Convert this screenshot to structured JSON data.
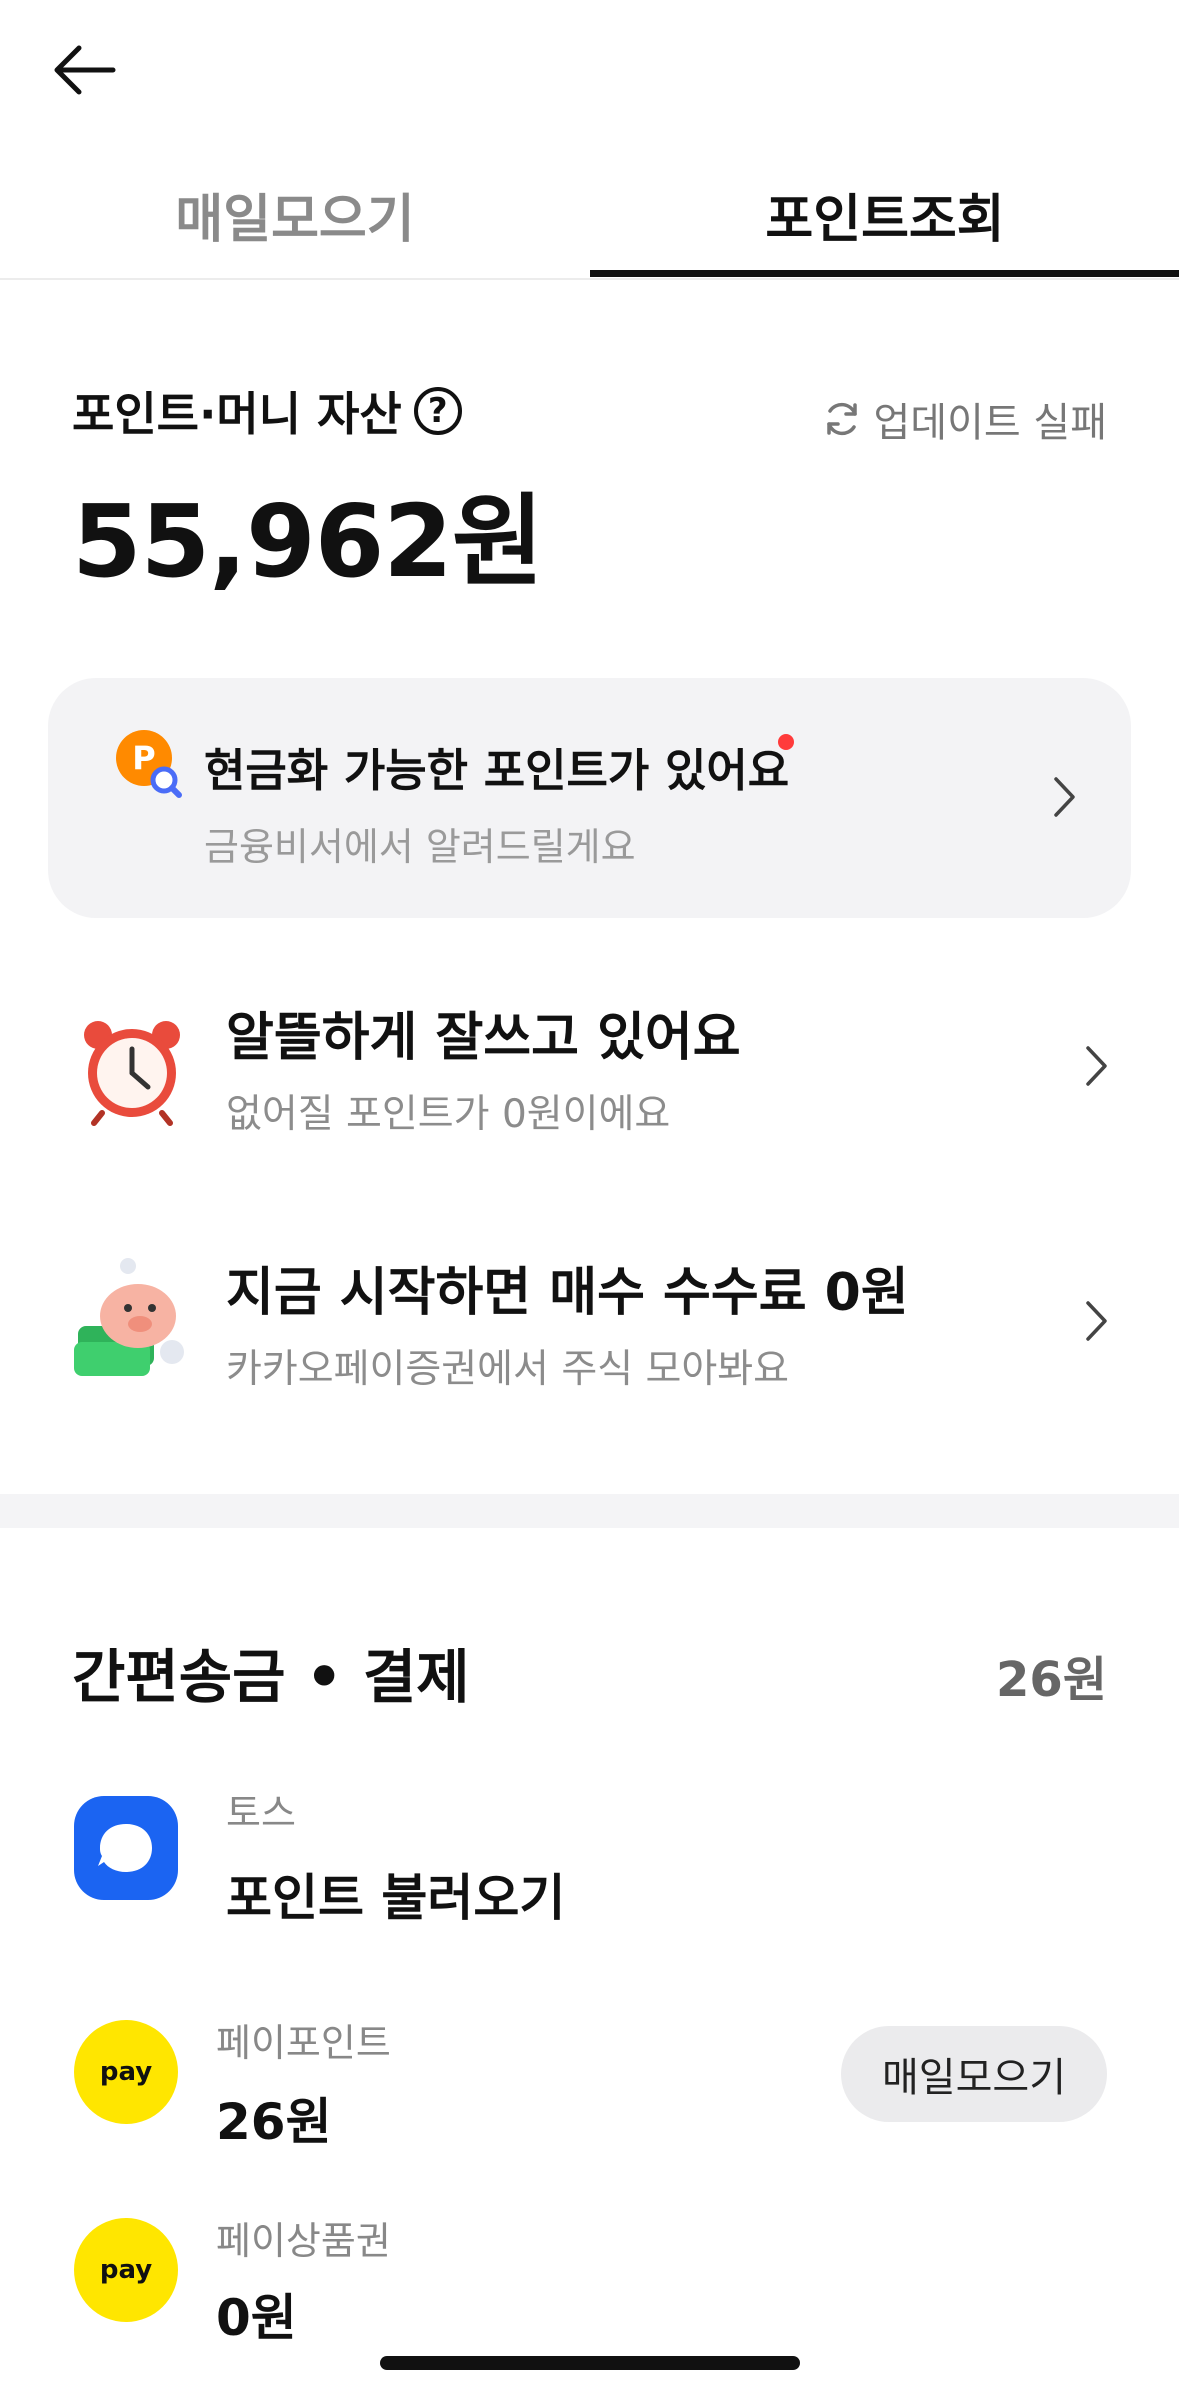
{
  "tabs": {
    "daily": "매일모으기",
    "points": "포인트조회"
  },
  "assets": {
    "title": "포인트·머니 자산",
    "help": "?",
    "update_status": "업데이트 실패",
    "amount": "55,962원"
  },
  "notice": {
    "title": "현금화 가능한 포인트가 있어요",
    "subtitle": "금융비서에서 알려드릴게요",
    "icon_letter": "P"
  },
  "rows": [
    {
      "title": "알뜰하게 잘쓰고 있어요",
      "subtitle": "없어질 포인트가 0원이에요",
      "icon": "alarm-clock-icon"
    },
    {
      "title": "지금 시작하면 매수 수수료 0원",
      "subtitle": "카카오페이증권에서 주식 모아봐요",
      "icon": "piggy-bank-icon"
    }
  ],
  "section": {
    "title": "간편송금 • 결제",
    "total": "26원",
    "items": [
      {
        "label": "토스",
        "value": "포인트 불러오기",
        "icon": "toss-icon"
      },
      {
        "label": "페이포인트",
        "value": "26원",
        "icon": "kakaopay-icon",
        "icon_text": "pay",
        "button": "매일모으기"
      },
      {
        "label": "페이상품권",
        "value": "0원",
        "icon": "kakaopay-icon",
        "icon_text": "pay"
      }
    ]
  },
  "colors": {
    "toss_blue": "#1b64f2",
    "kakao_yellow": "#ffe600",
    "notification_red": "#ff3b3b",
    "point_orange": "#ff8a00"
  }
}
